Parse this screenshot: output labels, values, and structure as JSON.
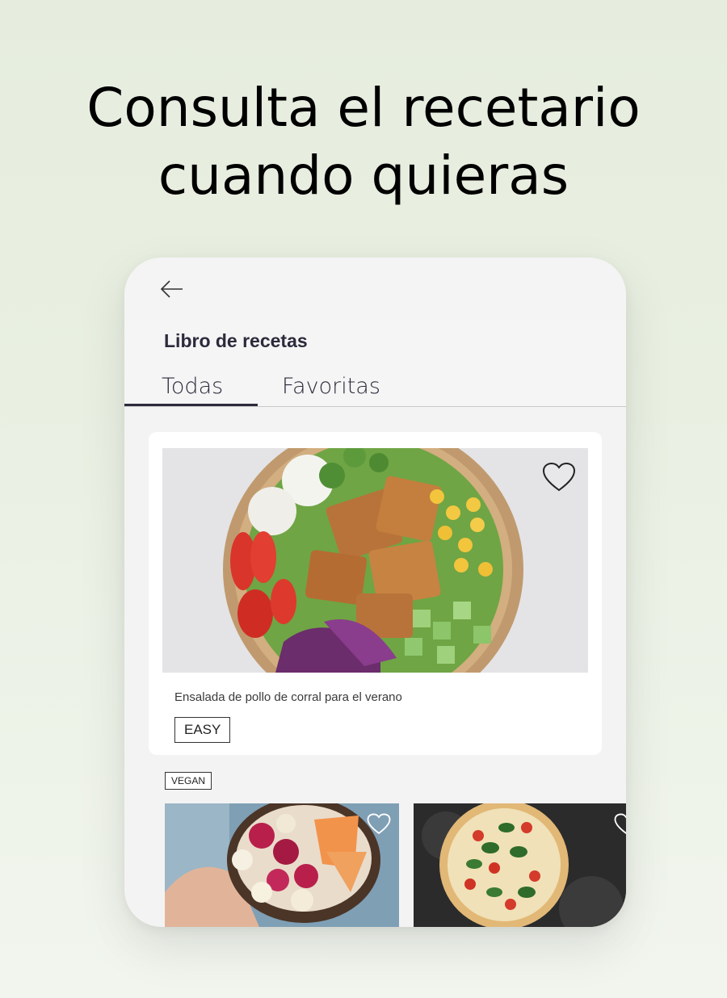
{
  "headline": {
    "line1": "Consulta el recetario",
    "line2": "cuando quieras"
  },
  "app": {
    "back_icon": "arrow-left-icon",
    "page_title": "Libro de recetas",
    "tabs": [
      {
        "label": "Todas",
        "active": true
      },
      {
        "label": "Favoritas",
        "active": false
      }
    ],
    "featured": {
      "title": "Ensalada de pollo de corral para el verano",
      "difficulty": "EASY",
      "favorite_icon": "heart-outline-icon"
    },
    "section_tag": "VEGAN",
    "thumbnails": [
      {
        "name": "smoothie-bowl",
        "favorite_icon": "heart-outline-icon"
      },
      {
        "name": "pizza",
        "favorite_icon": "heart-outline-icon"
      }
    ]
  },
  "colors": {
    "text_dark": "#2b2b3c",
    "background": "#e9f0e2",
    "card": "#ffffff"
  }
}
